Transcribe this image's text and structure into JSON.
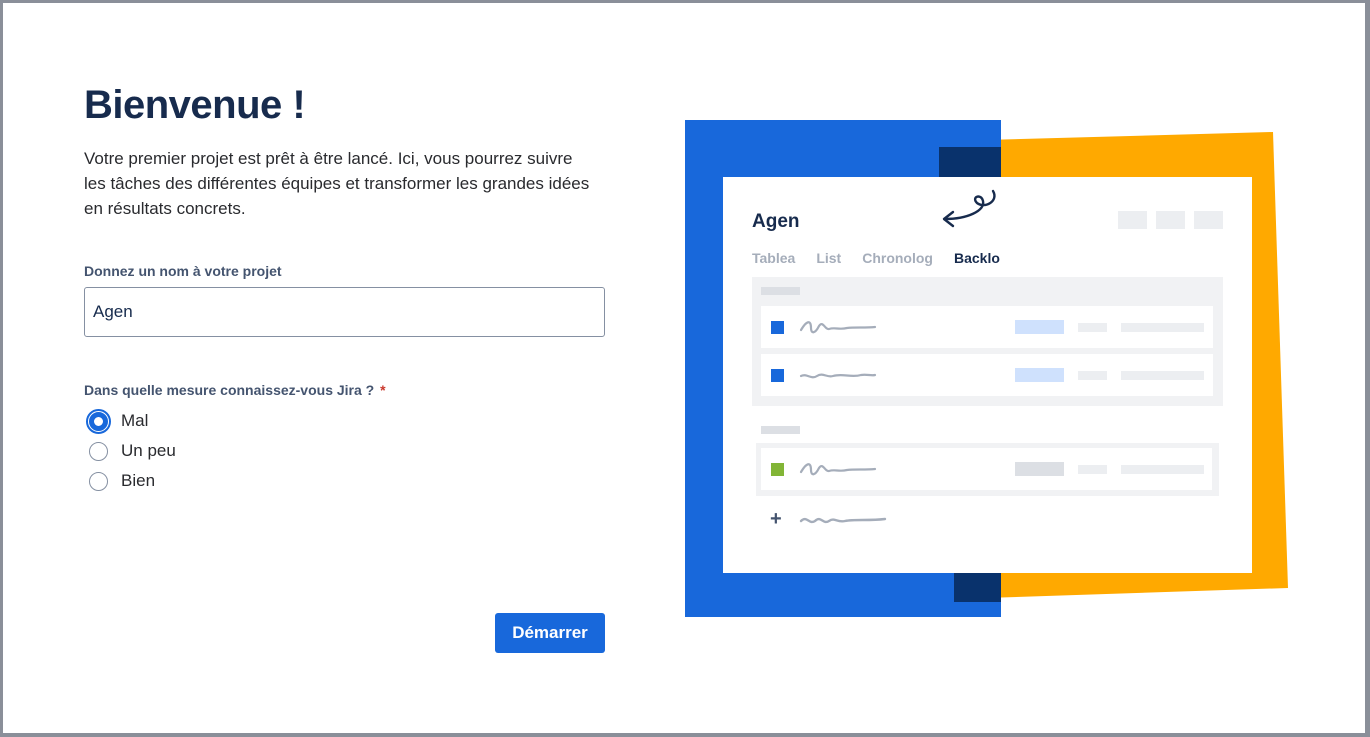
{
  "welcome": {
    "title": "Bienvenue !",
    "intro": "Votre premier projet est prêt à être lancé. Ici, vous pourrez suivre les tâches des différentes équipes et transformer les grandes idées en résultats concrets."
  },
  "project_name": {
    "label": "Donnez un nom à votre projet",
    "value": "Agen"
  },
  "experience": {
    "label": "Dans quelle mesure connaissez-vous Jira ?",
    "required_mark": "*",
    "options": [
      {
        "label": "Mal",
        "selected": true
      },
      {
        "label": "Un peu",
        "selected": false
      },
      {
        "label": "Bien",
        "selected": false
      }
    ]
  },
  "start_button": "Démarrer",
  "illustration": {
    "project_title": "Agen",
    "tabs": [
      "Tablea",
      "List",
      "Chronolog",
      "Backlo"
    ],
    "active_tab": "Backlo",
    "colors": {
      "blue": "#1868db",
      "orange": "#ffa900",
      "dark_blue": "#09326c",
      "green": "#82b536",
      "light_blue": "#cfe1fd"
    }
  }
}
